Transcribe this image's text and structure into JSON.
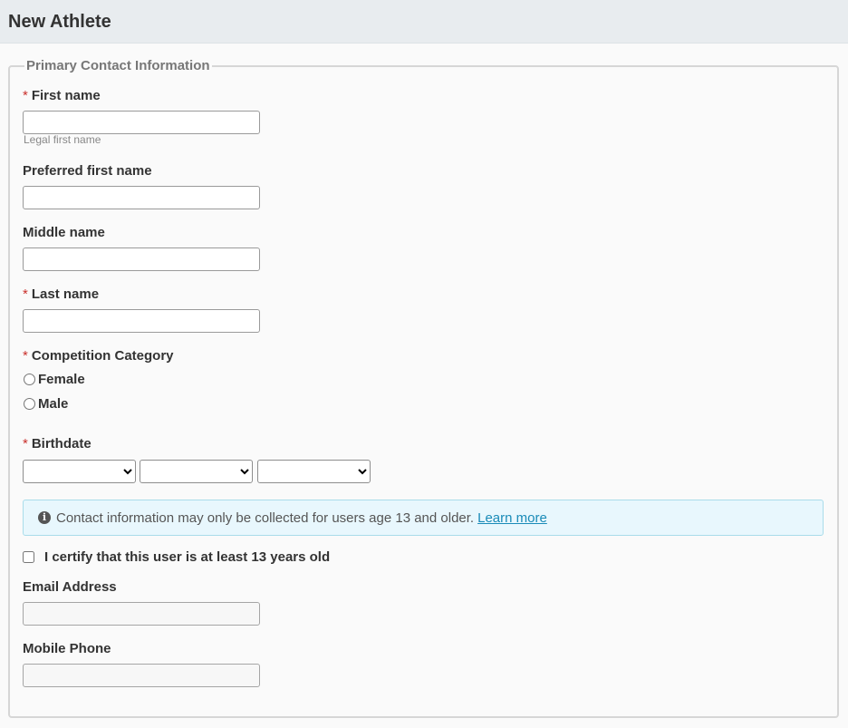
{
  "header": {
    "title": "New Athlete"
  },
  "section": {
    "legend": "Primary Contact Information"
  },
  "fields": {
    "first_name": {
      "label": "First name",
      "required": "*",
      "value": "",
      "hint": "Legal first name"
    },
    "preferred_first_name": {
      "label": "Preferred first name",
      "value": ""
    },
    "middle_name": {
      "label": "Middle name",
      "value": ""
    },
    "last_name": {
      "label": "Last name",
      "required": "*",
      "value": ""
    },
    "competition_category": {
      "label": "Competition Category",
      "required": "*",
      "options": [
        "Female",
        "Male"
      ],
      "selected": ""
    },
    "birthdate": {
      "label": "Birthdate",
      "required": "*",
      "month": "",
      "day": "",
      "year": ""
    },
    "email": {
      "label": "Email Address",
      "value": ""
    },
    "mobile_phone": {
      "label": "Mobile Phone",
      "value": ""
    }
  },
  "info": {
    "icon": "info-circle-icon",
    "text": "Contact information may only be collected for users age 13 and older.",
    "link": "Learn more"
  },
  "certify": {
    "label": "I certify that this user is at least 13 years old",
    "checked": false
  }
}
